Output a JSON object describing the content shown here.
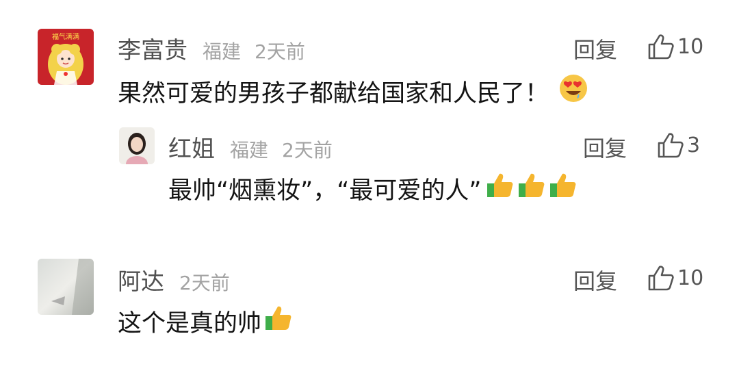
{
  "comments": [
    {
      "author": "李富贵",
      "location": "福建",
      "time": "2天前",
      "text": "果然可爱的男孩子都献给国家和人民了！",
      "emojis": [
        "heart-eyes-emoji"
      ],
      "reply_label": "回复",
      "likes": "10",
      "avatar_text": "福气满满",
      "replies": [
        {
          "author": "红姐",
          "location": "福建",
          "time": "2天前",
          "text": "最帅“烟熏妆”，“最可爱的人”",
          "emojis": [
            "thumbs-up-emoji",
            "thumbs-up-emoji",
            "thumbs-up-emoji"
          ],
          "reply_label": "回复",
          "likes": "3"
        }
      ]
    },
    {
      "author": "阿达",
      "time": "2天前",
      "text": "这个是真的帅",
      "emojis": [
        "thumbs-up-emoji"
      ],
      "reply_label": "回复",
      "likes": "10"
    }
  ],
  "colors": {
    "author": "#505050",
    "meta": "#a3a3a3",
    "text": "#141414",
    "action": "#555555",
    "thumb_yellow": "#f5b52e",
    "thumb_green": "#3fae4a"
  }
}
